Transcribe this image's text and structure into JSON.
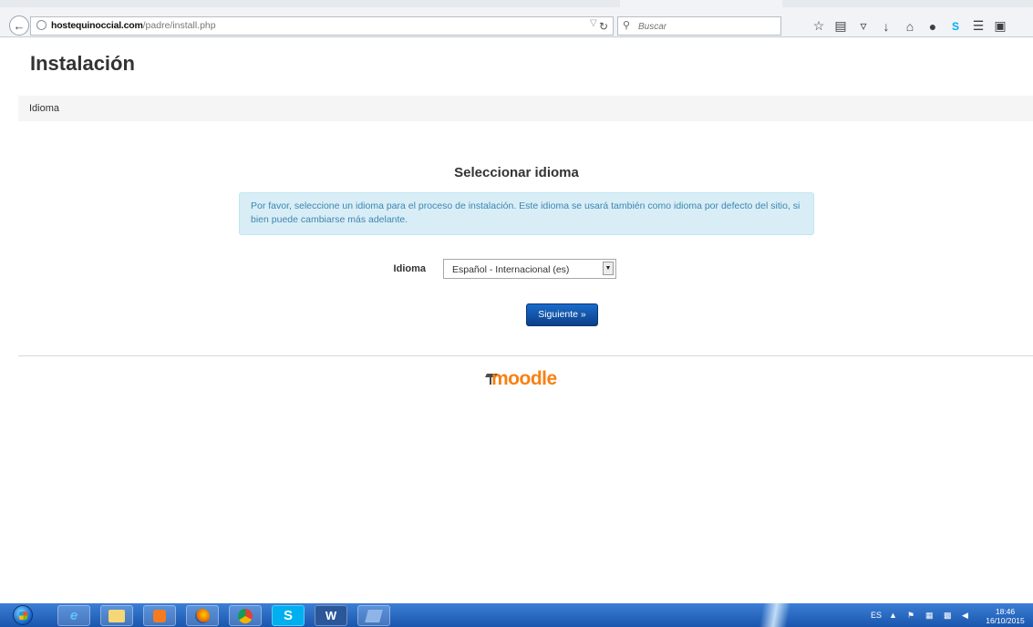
{
  "browser": {
    "url_host": "hostequinoccial.com",
    "url_path": "/padre/install.php",
    "search_placeholder": "Buscar",
    "icons": [
      "back-arrow-icon",
      "globe-icon",
      "reload-icon",
      "search-icon",
      "bookmark-star-icon",
      "reading-list-icon",
      "pocket-icon",
      "download-icon",
      "home-icon",
      "chat-icon",
      "skype-icon",
      "menu-icon",
      "extension-icon"
    ]
  },
  "page": {
    "title": "Instalación",
    "breadcrumb": "Idioma",
    "section_title": "Seleccionar idioma",
    "info_text": "Por favor, seleccione un idioma para el proceso de instalación. Este idioma se usará también como idioma por defecto del sitio, si bien puede cambiarse más adelante.",
    "language_label": "Idioma",
    "language_selected": "Español - Internacional (es)",
    "next_button": "Siguiente »",
    "logo_text": "moodle"
  },
  "taskbar": {
    "apps": [
      "windows-start-icon",
      "internet-explorer-icon",
      "file-explorer-icon",
      "media-player-icon",
      "firefox-icon",
      "chrome-icon",
      "skype-icon",
      "word-icon",
      "virtualbox-icon"
    ],
    "language_indicator": "ES",
    "time": "18:46",
    "date": "16/10/2015"
  },
  "colors": {
    "info_background": "#d9edf7",
    "info_text": "#3a87ad",
    "button_primary": "#0f4b9c",
    "moodle_orange": "#f98012",
    "taskbar": "#1f5fb7"
  }
}
